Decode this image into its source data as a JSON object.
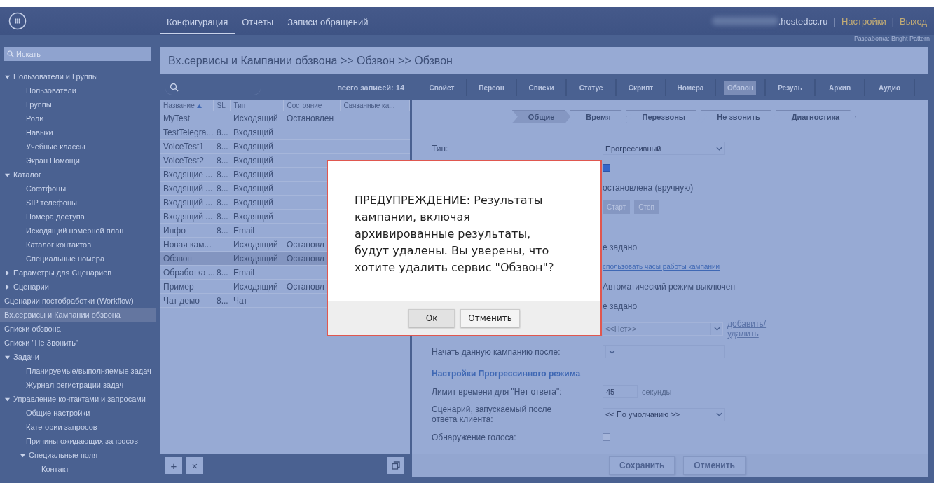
{
  "header": {
    "nav": [
      {
        "label": "Конфигурация",
        "selected": true
      },
      {
        "label": "Отчеты",
        "selected": false
      },
      {
        "label": "Записи обращений",
        "selected": false
      }
    ],
    "domain": ".hostedcc.ru",
    "separator_1": "|",
    "settings_link": "Настройки",
    "separator_2": "|",
    "logout_link": "Выход",
    "credit": "Разработка: Bright Pattern"
  },
  "sidebar": {
    "search": {
      "placeholder": "Искать"
    },
    "items": [
      {
        "label": "Пользователи и Группы",
        "selected": false,
        "expanded": true,
        "children": [
          {
            "label": "Пользователи",
            "selected": false
          },
          {
            "label": "Группы",
            "selected": false
          },
          {
            "label": "Роли",
            "selected": false
          },
          {
            "label": "Навыки",
            "selected": false
          },
          {
            "label": "Учебные классы",
            "selected": false
          },
          {
            "label": "Экран Помощи",
            "selected": false
          }
        ]
      },
      {
        "label": "Каталог",
        "selected": false,
        "expanded": true,
        "children": [
          {
            "label": "Софтфоны",
            "selected": false
          },
          {
            "label": "SIP телефоны",
            "selected": false
          },
          {
            "label": "Номера доступа",
            "selected": false
          },
          {
            "label": "Исходящий номерной план",
            "selected": false
          },
          {
            "label": "Каталог контактов",
            "selected": false
          },
          {
            "label": "Специальные номера",
            "selected": false
          }
        ]
      },
      {
        "label": "Параметры для Сценариев",
        "selected": false,
        "expanded": false
      },
      {
        "label": "Сценарии",
        "selected": false,
        "expanded": false
      },
      {
        "label": "Сценарии постобработки (Workflow)",
        "selected": false
      },
      {
        "label": "Вх.сервисы и Кампании обзвона",
        "selected": true
      },
      {
        "label": "Списки обзвона",
        "selected": false
      },
      {
        "label": "Списки \"Не Звонить\"",
        "selected": false
      },
      {
        "label": "Задачи",
        "selected": false,
        "expanded": true,
        "children": [
          {
            "label": "Планируемые/выполняемые задач",
            "selected": false
          },
          {
            "label": "Журнал регистрации задач",
            "selected": false
          }
        ]
      },
      {
        "label": "Управление контактами и запросами",
        "selected": false,
        "expanded": true,
        "children": [
          {
            "label": "Общие настройки",
            "selected": false
          },
          {
            "label": "Категории запросов",
            "selected": false
          },
          {
            "label": "Причины ожидающих запросов",
            "selected": false
          },
          {
            "label": "Специальные поля",
            "selected": false,
            "expanded": true,
            "children": [
              {
                "label": "Контакт",
                "selected": false
              }
            ]
          }
        ]
      }
    ]
  },
  "breadcrumb": "Вх.сервисы и Кампании обзвона >> Обзвон >> Обзвон",
  "list": {
    "total": "всего записей: 14",
    "columns": [
      {
        "label": "Название",
        "sorted": true
      },
      {
        "label": "SL",
        "sorted": false
      },
      {
        "label": "Тип",
        "sorted": false
      },
      {
        "label": "Состояние",
        "sorted": false
      },
      {
        "label": "Связанные ка...",
        "sorted": false
      }
    ],
    "rows": [
      {
        "cells": [
          "MyTest",
          "",
          "Исходящий",
          "Остановлен"
        ],
        "selected": false
      },
      {
        "cells": [
          "TestTelegra...",
          "8...",
          "Входящий",
          ""
        ],
        "selected": false
      },
      {
        "cells": [
          "VoiceTest1",
          "8...",
          "Входящий",
          ""
        ],
        "selected": false
      },
      {
        "cells": [
          "VoiceTest2",
          "8...",
          "Входящий",
          ""
        ],
        "selected": false
      },
      {
        "cells": [
          "Входящие ...",
          "8...",
          "Входящий",
          ""
        ],
        "selected": false
      },
      {
        "cells": [
          "Входящий ...",
          "8...",
          "Входящий",
          ""
        ],
        "selected": false
      },
      {
        "cells": [
          "Входящий ...",
          "8...",
          "Входящий",
          ""
        ],
        "selected": false
      },
      {
        "cells": [
          "Входящий ...",
          "8...",
          "Входящий",
          ""
        ],
        "selected": false
      },
      {
        "cells": [
          "Инфо",
          "8...",
          "Email",
          ""
        ],
        "selected": false
      },
      {
        "cells": [
          "Новая кам...",
          "",
          "Исходящий",
          "Остановл"
        ],
        "selected": false
      },
      {
        "cells": [
          "Обзвон",
          "",
          "Исходящий",
          "Остановл"
        ],
        "selected": true
      },
      {
        "cells": [
          "Обработка ...",
          "8...",
          "Email",
          ""
        ],
        "selected": false
      },
      {
        "cells": [
          "Пример",
          "",
          "Исходящий",
          "Остановл"
        ],
        "selected": false
      },
      {
        "cells": [
          "Чат демо",
          "8...",
          "Чат",
          ""
        ],
        "selected": false
      }
    ],
    "toolbar": [
      "+",
      "×"
    ]
  },
  "tabs": [
    {
      "label": "Свойст",
      "selected": false
    },
    {
      "label": "Персон",
      "selected": false
    },
    {
      "label": "Списки",
      "selected": false
    },
    {
      "label": "Статус",
      "selected": false
    },
    {
      "label": "Скрипт",
      "selected": false
    },
    {
      "label": "Номера",
      "selected": false
    },
    {
      "label": "Обзвон",
      "selected": true
    },
    {
      "label": "Резуль",
      "selected": false
    },
    {
      "label": "Архив",
      "selected": false
    },
    {
      "label": "Аудио",
      "selected": false
    }
  ],
  "steps": [
    {
      "label": "Общие",
      "selected": true
    },
    {
      "label": "Время",
      "selected": false
    },
    {
      "label": "Перезвоны",
      "selected": false
    },
    {
      "label": "Не звонить",
      "selected": false
    },
    {
      "label": "Диагностика",
      "selected": false
    }
  ],
  "form": [
    {
      "kind": "select",
      "label": "Тип:",
      "value": "Прогрессивный",
      "disabled": false
    },
    {
      "kind": "checkbox",
      "checked": true
    },
    {
      "kind": "text",
      "value": "остановлена (вручную)"
    },
    {
      "kind": "buttons",
      "buttons": [
        "Старт",
        "Стоп"
      ]
    },
    {
      "kind": "spacer"
    },
    {
      "kind": "text",
      "value": "е задано"
    },
    {
      "kind": "link",
      "value": "спользовать часы работы кампании"
    },
    {
      "kind": "text",
      "value": "Автоматический режим выключен"
    },
    {
      "kind": "text",
      "value": "е задано"
    },
    {
      "kind": "select",
      "value": "<<Нет>>",
      "disabled": true,
      "link": "добавить/ удалить"
    },
    {
      "kind": "select",
      "label": "Начать данную кампанию после:"
    },
    {
      "kind": "section",
      "label": "Настройки Прогрессивного режима"
    },
    {
      "kind": "input",
      "label": "Лимит времени для \"Нет ответа\":",
      "value": "45",
      "unit": "секунды"
    },
    {
      "kind": "select",
      "label": "Сценарий, запускаемый после ответа клиента:",
      "value": "<< По умолчанию >>",
      "disabled": false
    },
    {
      "kind": "checkbox",
      "label": "Обнаружение голоса:",
      "checked": false,
      "disabled": true
    }
  ],
  "footer_buttons": [
    "Сохранить",
    "Отменить"
  ],
  "dialog": {
    "message": "ПРЕДУПРЕЖДЕНИЕ: Результаты кампании, включая архивированные результаты, будут удалены. Вы уверены, что хотите удалить сервис \"Обзвон\"?",
    "buttons": [
      "Ок",
      "Отменить"
    ]
  }
}
